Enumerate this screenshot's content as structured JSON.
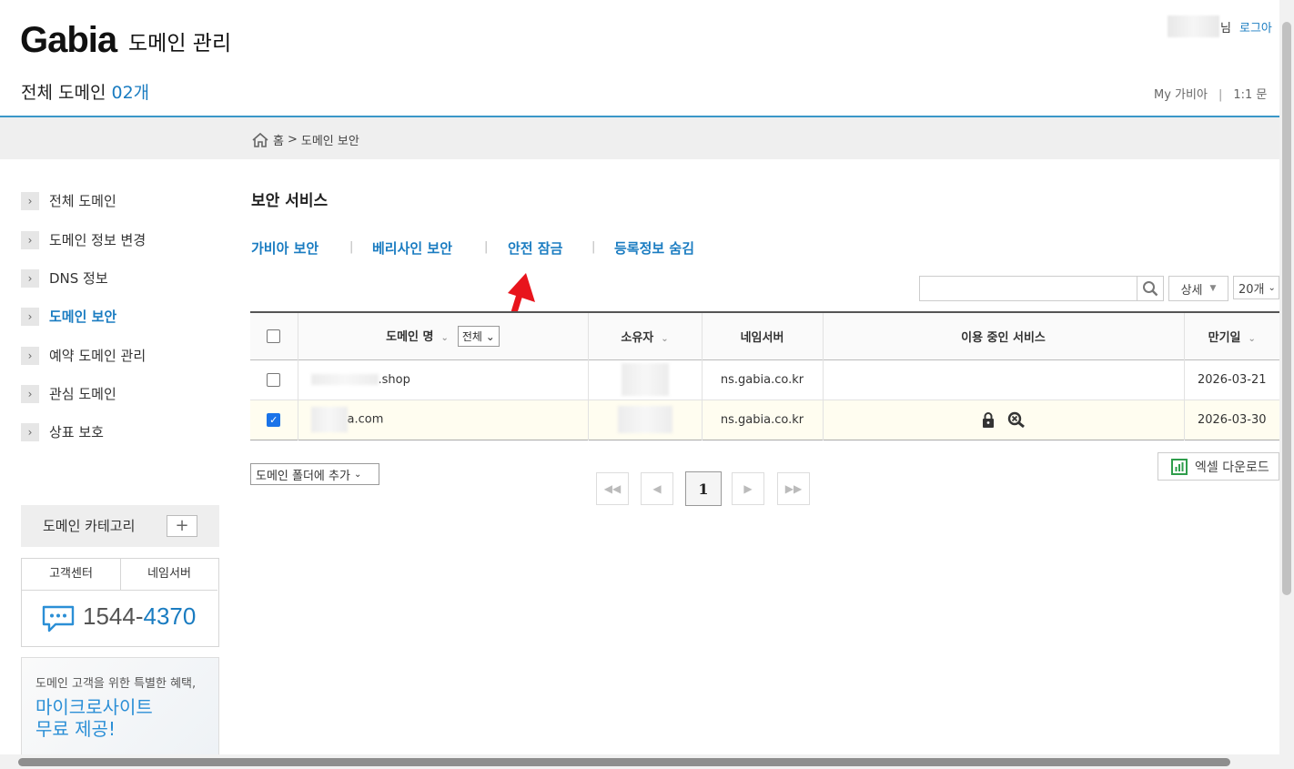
{
  "header": {
    "logo": "Gabia",
    "title": "도메인 관리",
    "user_suffix": "님",
    "logout": "로그아",
    "total_label": "전체 도메인",
    "total_count": "02개",
    "links": [
      "My 가비아",
      "1:1 문"
    ]
  },
  "breadcrumb": {
    "home": "홈",
    "sep": ">",
    "current": "도메인 보안"
  },
  "sidebar": {
    "items": [
      {
        "label": "전체 도메인"
      },
      {
        "label": "도메인 정보 변경"
      },
      {
        "label": "DNS 정보"
      },
      {
        "label": "도메인 보안",
        "active": true
      },
      {
        "label": "예약 도메인 관리"
      },
      {
        "label": "관심 도메인"
      },
      {
        "label": "상표 보호"
      }
    ],
    "category_label": "도메인 카테고리",
    "category_add": "+",
    "cs_tabs": [
      "고객센터",
      "네임서버"
    ],
    "phone_prefix": "1544-",
    "phone_suffix": "4370",
    "promo_sub": "도메인 고객을 위한 특별한 혜택,",
    "promo_title_1": "마이크로사이트",
    "promo_title_2": "무료 제공!"
  },
  "main": {
    "section_title": "보안 서비스",
    "tabs": [
      "가비아 보안",
      "베리사인 보안",
      "안전 잠금",
      "등록정보 숨김"
    ],
    "tab_sep": "|",
    "search_placeholder": "",
    "detail_label": "상세",
    "per_page": "20개",
    "columns": {
      "domain": "도메인 명",
      "domain_filter": "전체",
      "owner": "소유자",
      "nameserver": "네임서버",
      "services": "이용 중인 서비스",
      "expiry": "만기일"
    },
    "rows": [
      {
        "domain": ".shop",
        "nameserver": "ns.gabia.co.kr",
        "expiry": "2026-03-21",
        "checked": false
      },
      {
        "domain": "a.com",
        "nameserver": "ns.gabia.co.kr",
        "expiry": "2026-03-30",
        "checked": true
      }
    ],
    "folder_select": "도메인 폴더에 추가",
    "excel": "엑셀 다운로드",
    "current_page": "1"
  },
  "colors": {
    "accent": "#1a7cc1",
    "arrow": "#e8141c"
  }
}
